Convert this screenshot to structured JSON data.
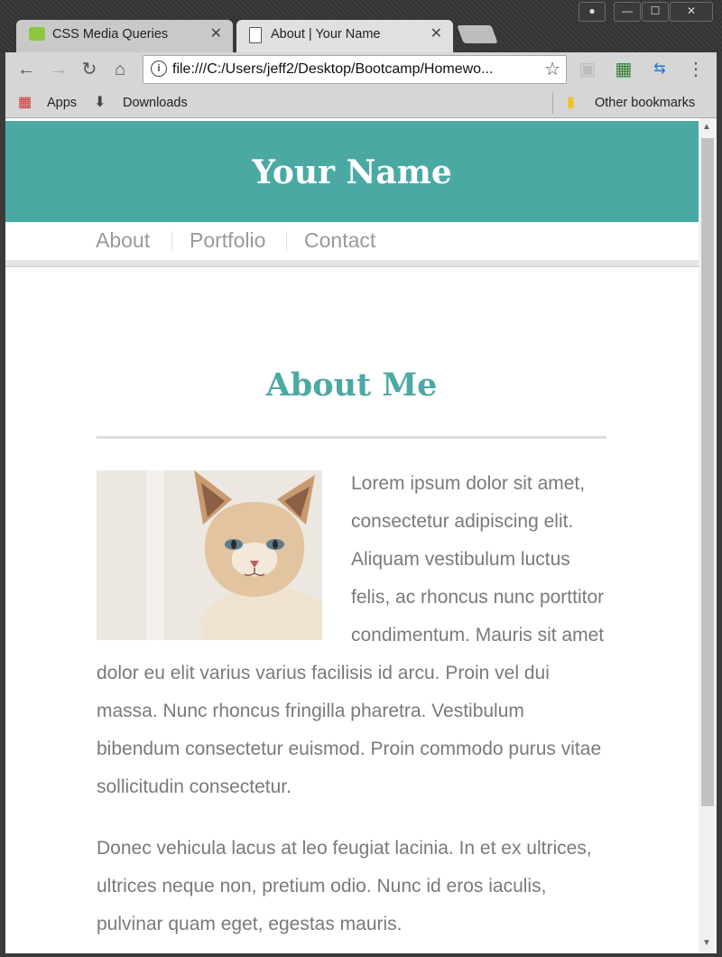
{
  "window": {
    "minimize": "—",
    "maximize": "☐",
    "close": "✕",
    "user_icon": "user-icon"
  },
  "tabs": [
    {
      "title": "CSS Media Queries",
      "favicon": "w3-icon",
      "close": "✕",
      "active": false
    },
    {
      "title": "About | Your Name",
      "favicon": "page-icon",
      "close": "✕",
      "active": true
    }
  ],
  "toolbar": {
    "url": "file:///C:/Users/jeff2/Desktop/Bootcamp/Homewo..."
  },
  "bookmarks": {
    "apps": "Apps",
    "downloads": "Downloads",
    "other": "Other bookmarks"
  },
  "page": {
    "header_title": "Your Name",
    "nav": [
      "About",
      "Portfolio",
      "Contact"
    ],
    "heading": "About Me",
    "image_alt": "cat photo",
    "paragraphs": [
      "Lorem ipsum dolor sit amet, consectetur adipiscing elit. Aliquam vestibulum luctus felis, ac rhoncus nunc porttitor condimentum. Mauris sit amet dolor eu elit varius varius facilisis id arcu. Proin vel dui massa. Nunc rhoncus fringilla pharetra. Vestibulum bibendum consectetur euismod. Proin commodo purus vitae sollicitudin consectetur.",
      "Donec vehicula lacus at leo feugiat lacinia. In et ex ultrices, ultrices neque non, pretium odio. Nunc id eros iaculis, pulvinar quam eget, egestas mauris."
    ]
  },
  "colors": {
    "accent": "#4aa9a3",
    "text": "#7a7a7a",
    "nav": "#999999"
  }
}
